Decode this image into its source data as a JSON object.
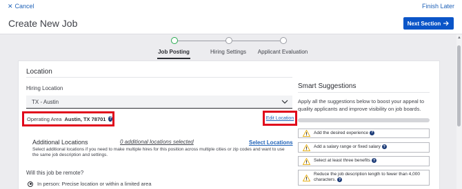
{
  "topbar": {
    "cancel_label": "Cancel",
    "finish_label": "Finish Later"
  },
  "header": {
    "title": "Create New Job",
    "next_label": "Next Section"
  },
  "stepper": {
    "steps": [
      {
        "label": "Job Posting",
        "active": true
      },
      {
        "label": "Hiring Settings",
        "active": false
      },
      {
        "label": "Applicant Evaluation",
        "active": false
      }
    ]
  },
  "location": {
    "title": "Location",
    "hiring_location_label": "Hiring Location",
    "hiring_location_value": "TX - Austin",
    "operating_area_label": "Operating Area",
    "operating_area_value": "Austin, TX 78701",
    "edit_location_label": "Edit Location",
    "additional_title": "Additional Locations",
    "additional_count": "0 additional locations selected",
    "select_locations_label": "Select Locations",
    "additional_desc": "Select additional locations if you need to make multiple hires for this position across multiple cities or zip codes and want to use the same job description and settings.",
    "remote_question": "Will this job be remote?",
    "remote_option_1": "In person: Precise location or within a limited area"
  },
  "smart": {
    "title": "Smart Suggestions",
    "description": "Apply all the suggestions below to boost your appeal to quality applicants and improve visibility on job boards.",
    "progress": 0.0,
    "suggestions": [
      {
        "text": "Add the desired experience"
      },
      {
        "text": "Add a salary range or fixed salary"
      },
      {
        "text": "Select at least three benefits"
      },
      {
        "text": "Reduce the job description length to fewer than 4,000 characters."
      }
    ]
  },
  "colors": {
    "accent": "#0b55c8",
    "highlight": "#e0061b",
    "step_active": "#27a84f",
    "warning": "#e8b21a"
  },
  "icons": [
    "close-icon",
    "arrow-right-icon",
    "chevron-down-icon",
    "help-icon",
    "warning-icon",
    "radio-selected-icon"
  ]
}
